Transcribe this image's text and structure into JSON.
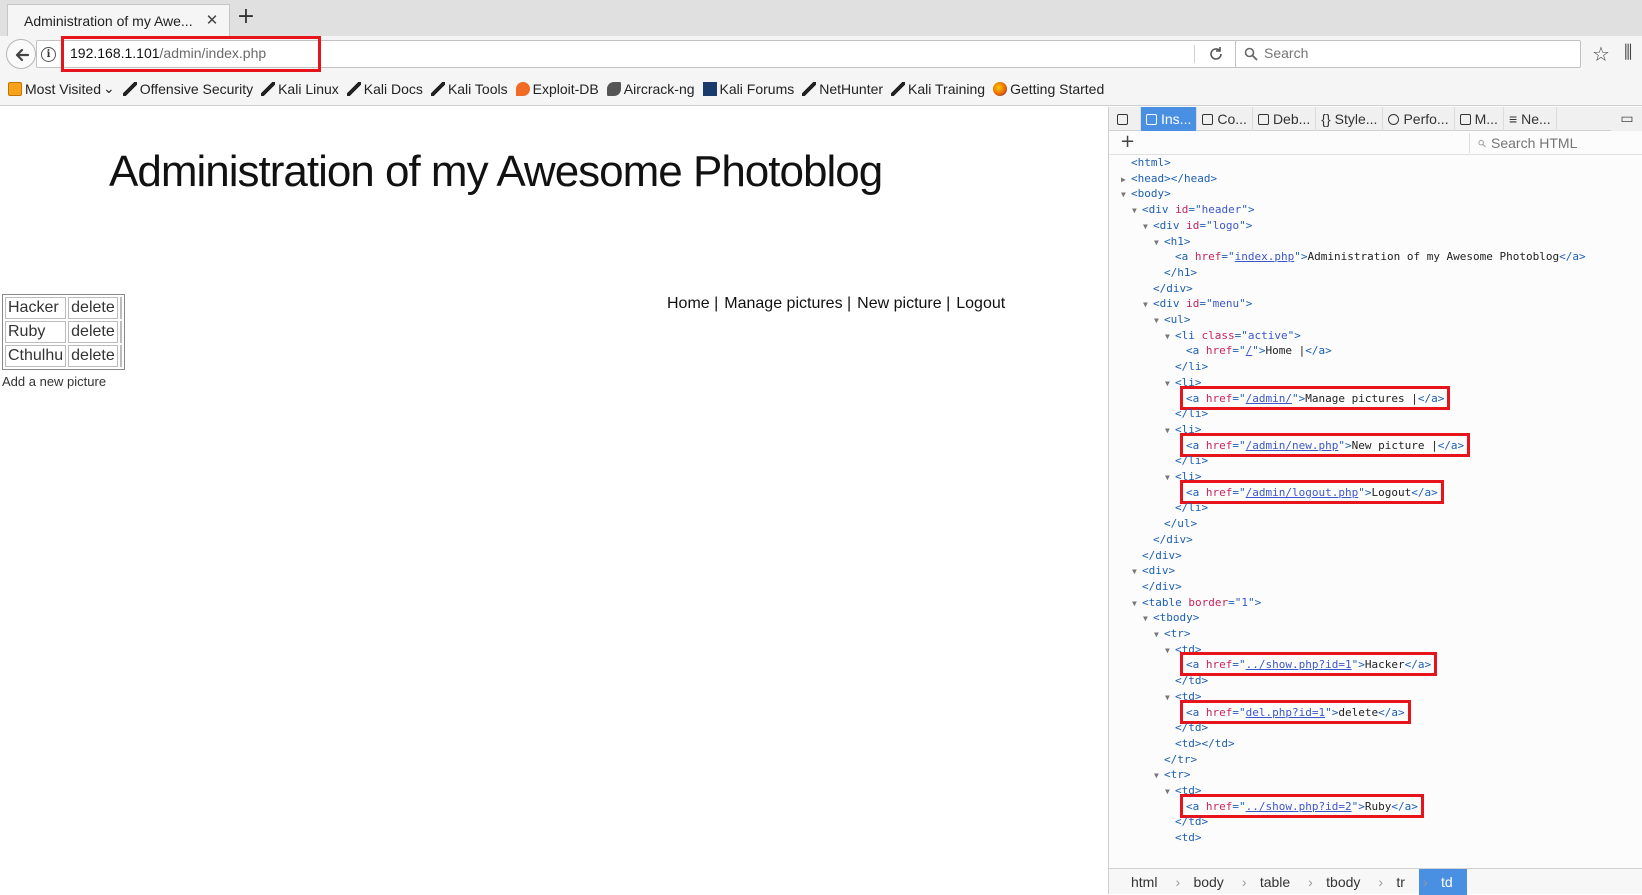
{
  "browser": {
    "tab_title": "Administration of my Awe...",
    "tab_close": "✕",
    "new_tab": "+",
    "url_host": "192.168.1.101",
    "url_path": "/admin/index.php",
    "search_placeholder": "Search",
    "highlight_color": "#e8141c"
  },
  "bookmarks": [
    {
      "label": "Most Visited",
      "icon": "folder-icon"
    },
    {
      "label": "Offensive Security",
      "icon": "kali-icon"
    },
    {
      "label": "Kali Linux",
      "icon": "kali-icon"
    },
    {
      "label": "Kali Docs",
      "icon": "kali-icon"
    },
    {
      "label": "Kali Tools",
      "icon": "kali-icon"
    },
    {
      "label": "Exploit-DB",
      "icon": "exploit-icon"
    },
    {
      "label": "Aircrack-ng",
      "icon": "aircrack-icon"
    },
    {
      "label": "Kali Forums",
      "icon": "forum-icon"
    },
    {
      "label": "NetHunter",
      "icon": "kali-icon"
    },
    {
      "label": "Kali Training",
      "icon": "kali-icon"
    },
    {
      "label": "Getting Started",
      "icon": "firefox-icon"
    }
  ],
  "page": {
    "title": "Administration of my Awesome Photoblog",
    "menu": [
      "Home |",
      "Manage pictures |",
      "New picture |",
      "Logout"
    ],
    "table_rows": [
      {
        "name": "Hacker",
        "action": "delete"
      },
      {
        "name": "Ruby",
        "action": "delete"
      },
      {
        "name": "Cthulhu",
        "action": "delete"
      }
    ],
    "add_link": "Add a new picture"
  },
  "devtools": {
    "tabs": [
      "Ins...",
      "Co...",
      "Deb...",
      "Style...",
      "Perfo...",
      "M...",
      "Ne..."
    ],
    "search_placeholder": "Search HTML",
    "breadcrumbs": [
      "html",
      "body",
      "table",
      "tbody",
      "tr",
      "td"
    ],
    "accent": "#4a90e2"
  },
  "dom_tree": [
    {
      "indent": 0,
      "twisty": "",
      "parts": [
        [
          "tg",
          "<html>"
        ]
      ]
    },
    {
      "indent": 0,
      "twisty": "▶",
      "parts": [
        [
          "tg",
          "<head></head>"
        ]
      ]
    },
    {
      "indent": 0,
      "twisty": "▼",
      "parts": [
        [
          "tg",
          "<body>"
        ]
      ]
    },
    {
      "indent": 1,
      "twisty": "▼",
      "parts": [
        [
          "tg",
          "<div "
        ],
        [
          "an",
          "id"
        ],
        [
          "tg",
          "=\""
        ],
        [
          "av",
          "header"
        ],
        [
          "tg",
          "\">"
        ]
      ]
    },
    {
      "indent": 2,
      "twisty": "▼",
      "parts": [
        [
          "tg",
          "<div "
        ],
        [
          "an",
          "id"
        ],
        [
          "tg",
          "=\""
        ],
        [
          "av",
          "logo"
        ],
        [
          "tg",
          "\">"
        ]
      ]
    },
    {
      "indent": 3,
      "twisty": "▼",
      "parts": [
        [
          "tg",
          "<h1>"
        ]
      ]
    },
    {
      "indent": 4,
      "twisty": "",
      "parts": [
        [
          "tg",
          "<a "
        ],
        [
          "an",
          "href"
        ],
        [
          "tg",
          "=\""
        ],
        [
          "avl",
          "index.php"
        ],
        [
          "tg",
          "\">"
        ],
        [
          "tx",
          "Administration of my Awesome Photoblog"
        ],
        [
          "tg",
          "</a>"
        ]
      ]
    },
    {
      "indent": 3,
      "twisty": "",
      "parts": [
        [
          "tg",
          "</h1>"
        ]
      ]
    },
    {
      "indent": 2,
      "twisty": "",
      "parts": [
        [
          "tg",
          "</div>"
        ]
      ]
    },
    {
      "indent": 2,
      "twisty": "▼",
      "parts": [
        [
          "tg",
          "<div "
        ],
        [
          "an",
          "id"
        ],
        [
          "tg",
          "=\""
        ],
        [
          "av",
          "menu"
        ],
        [
          "tg",
          "\">"
        ]
      ]
    },
    {
      "indent": 3,
      "twisty": "▼",
      "parts": [
        [
          "tg",
          "<ul>"
        ]
      ]
    },
    {
      "indent": 4,
      "twisty": "▼",
      "parts": [
        [
          "tg",
          "<li "
        ],
        [
          "an",
          "class"
        ],
        [
          "tg",
          "=\""
        ],
        [
          "av",
          "active"
        ],
        [
          "tg",
          "\">"
        ]
      ]
    },
    {
      "indent": 5,
      "twisty": "",
      "parts": [
        [
          "tg",
          "<a "
        ],
        [
          "an",
          "href"
        ],
        [
          "tg",
          "=\""
        ],
        [
          "avl",
          "/"
        ],
        [
          "tg",
          "\">"
        ],
        [
          "tx",
          "Home |"
        ],
        [
          "tg",
          "</a>"
        ]
      ]
    },
    {
      "indent": 4,
      "twisty": "",
      "parts": [
        [
          "tg",
          "</li>"
        ]
      ]
    },
    {
      "indent": 4,
      "twisty": "▼",
      "parts": [
        [
          "tg",
          "<li>"
        ]
      ]
    },
    {
      "indent": 5,
      "twisty": "",
      "hl": true,
      "parts": [
        [
          "tg",
          "<a "
        ],
        [
          "an",
          "href"
        ],
        [
          "tg",
          "=\""
        ],
        [
          "avl",
          "/admin/"
        ],
        [
          "tg",
          "\">"
        ],
        [
          "tx",
          "Manage pictures |"
        ],
        [
          "tg",
          "</a>"
        ]
      ]
    },
    {
      "indent": 4,
      "twisty": "",
      "parts": [
        [
          "tg",
          "</li>"
        ]
      ]
    },
    {
      "indent": 4,
      "twisty": "▼",
      "parts": [
        [
          "tg",
          "<li>"
        ]
      ]
    },
    {
      "indent": 5,
      "twisty": "",
      "hl": true,
      "parts": [
        [
          "tg",
          "<a "
        ],
        [
          "an",
          "href"
        ],
        [
          "tg",
          "=\""
        ],
        [
          "avl",
          "/admin/new.php"
        ],
        [
          "tg",
          "\">"
        ],
        [
          "tx",
          "New picture |"
        ],
        [
          "tg",
          "</a>"
        ]
      ]
    },
    {
      "indent": 4,
      "twisty": "",
      "parts": [
        [
          "tg",
          "</li>"
        ]
      ]
    },
    {
      "indent": 4,
      "twisty": "▼",
      "parts": [
        [
          "tg",
          "<li>"
        ]
      ]
    },
    {
      "indent": 5,
      "twisty": "",
      "hl": true,
      "parts": [
        [
          "tg",
          "<a "
        ],
        [
          "an",
          "href"
        ],
        [
          "tg",
          "=\""
        ],
        [
          "avl",
          "/admin/logout.php"
        ],
        [
          "tg",
          "\">"
        ],
        [
          "tx",
          "Logout"
        ],
        [
          "tg",
          "</a>"
        ]
      ]
    },
    {
      "indent": 4,
      "twisty": "",
      "parts": [
        [
          "tg",
          "</li>"
        ]
      ]
    },
    {
      "indent": 3,
      "twisty": "",
      "parts": [
        [
          "tg",
          "</ul>"
        ]
      ]
    },
    {
      "indent": 2,
      "twisty": "",
      "parts": [
        [
          "tg",
          "</div>"
        ]
      ]
    },
    {
      "indent": 1,
      "twisty": "",
      "parts": [
        [
          "tg",
          "</div>"
        ]
      ]
    },
    {
      "indent": 1,
      "twisty": "▼",
      "parts": [
        [
          "tg",
          "<div>"
        ]
      ]
    },
    {
      "indent": 1,
      "twisty": "",
      "parts": [
        [
          "tg",
          "</div>"
        ]
      ]
    },
    {
      "indent": 1,
      "twisty": "▼",
      "parts": [
        [
          "tg",
          "<table "
        ],
        [
          "an",
          "border"
        ],
        [
          "tg",
          "=\""
        ],
        [
          "av",
          "1"
        ],
        [
          "tg",
          "\">"
        ]
      ]
    },
    {
      "indent": 2,
      "twisty": "▼",
      "parts": [
        [
          "tg",
          "<tbody>"
        ]
      ]
    },
    {
      "indent": 3,
      "twisty": "▼",
      "parts": [
        [
          "tg",
          "<tr>"
        ]
      ]
    },
    {
      "indent": 4,
      "twisty": "▼",
      "parts": [
        [
          "tg",
          "<td>"
        ]
      ]
    },
    {
      "indent": 5,
      "twisty": "",
      "hl": true,
      "parts": [
        [
          "tg",
          "<a "
        ],
        [
          "an",
          "href"
        ],
        [
          "tg",
          "=\""
        ],
        [
          "avl",
          "../show.php?id=1"
        ],
        [
          "tg",
          "\">"
        ],
        [
          "tx",
          "Hacker"
        ],
        [
          "tg",
          "</a>"
        ]
      ]
    },
    {
      "indent": 4,
      "twisty": "",
      "parts": [
        [
          "tg",
          "</td>"
        ]
      ]
    },
    {
      "indent": 4,
      "twisty": "▼",
      "parts": [
        [
          "tg",
          "<td>"
        ]
      ]
    },
    {
      "indent": 5,
      "twisty": "",
      "hl": true,
      "parts": [
        [
          "tg",
          "<a "
        ],
        [
          "an",
          "href"
        ],
        [
          "tg",
          "=\""
        ],
        [
          "avl",
          "del.php?id=1"
        ],
        [
          "tg",
          "\">"
        ],
        [
          "tx",
          "delete"
        ],
        [
          "tg",
          "</a>"
        ]
      ]
    },
    {
      "indent": 4,
      "twisty": "",
      "parts": [
        [
          "tg",
          "</td>"
        ]
      ]
    },
    {
      "indent": 4,
      "twisty": "",
      "parts": [
        [
          "tg",
          "<td></td>"
        ]
      ]
    },
    {
      "indent": 3,
      "twisty": "",
      "parts": [
        [
          "tg",
          "</tr>"
        ]
      ]
    },
    {
      "indent": 3,
      "twisty": "▼",
      "parts": [
        [
          "tg",
          "<tr>"
        ]
      ]
    },
    {
      "indent": 4,
      "twisty": "▼",
      "parts": [
        [
          "tg",
          "<td>"
        ]
      ]
    },
    {
      "indent": 5,
      "twisty": "",
      "hl": true,
      "parts": [
        [
          "tg",
          "<a "
        ],
        [
          "an",
          "href"
        ],
        [
          "tg",
          "=\""
        ],
        [
          "avl",
          "../show.php?id=2"
        ],
        [
          "tg",
          "\">"
        ],
        [
          "tx",
          "Ruby"
        ],
        [
          "tg",
          "</a>"
        ]
      ]
    },
    {
      "indent": 4,
      "twisty": "",
      "parts": [
        [
          "tg",
          "</td>"
        ]
      ]
    },
    {
      "indent": 4,
      "twisty": "",
      "parts": [
        [
          "tg",
          "<td>"
        ]
      ]
    }
  ]
}
